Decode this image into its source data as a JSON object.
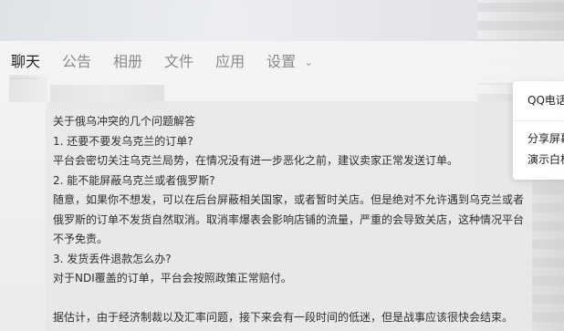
{
  "tabs": [
    {
      "label": "聊天"
    },
    {
      "label": "公告"
    },
    {
      "label": "相册"
    },
    {
      "label": "文件"
    },
    {
      "label": "应用"
    },
    {
      "label": "设置"
    }
  ],
  "message": {
    "lines": [
      "关于俄乌冲突的几个问题解答",
      "1. 还要不要发乌克兰的订单?",
      "平台会密切关注乌克兰局势，在情况没有进一步恶化之前，建议卖家正常发送订单。",
      "2. 能不能屏蔽乌克兰或者俄罗斯?",
      "随意，如果你不想发，可以在后台屏蔽相关国家，或者暂时关店。但是绝对不允许遇到乌克兰或者",
      "俄罗斯的订单不发货自然取消。取消率爆表会影响店铺的流量，严重的会导致关店，这种情况平台",
      "不予免责。",
      "3. 发货丢件退款怎么办?",
      "对于NDI覆盖的订单，平台会按照政策正常赔付。",
      "据估计，由于经济制裁以及汇率问题，接下来会有一段时间的低迷，但是战事应该很快会结束。"
    ]
  },
  "popup": {
    "items": [
      {
        "label": "QQ电话"
      },
      {
        "label": "分享屏幕"
      },
      {
        "label": "演示白板"
      }
    ]
  },
  "icons": {
    "settings_caret": "chevron-down-icon"
  }
}
